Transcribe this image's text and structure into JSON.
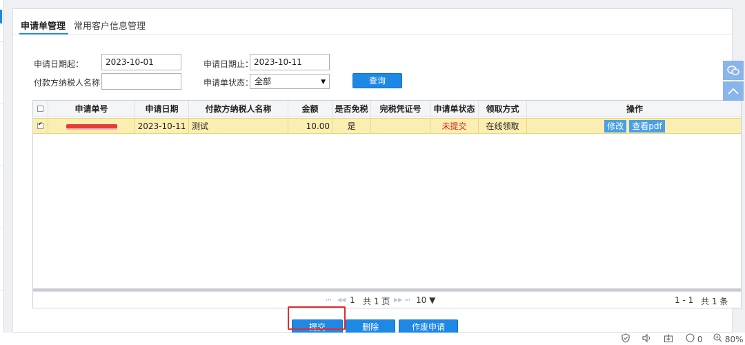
{
  "tabs": [
    {
      "label": "申请单管理"
    },
    {
      "label": "常用客户信息管理"
    }
  ],
  "filters": {
    "start_date_label": "申请日期起：",
    "start_date_value": "2023-10-01",
    "end_date_label": "申请日期止：",
    "end_date_value": "2023-10-11",
    "payer_label": "付款方纳税人名称：",
    "payer_value": "",
    "status_label": "申请单状态：",
    "status_value": "全部",
    "query_label": "查询"
  },
  "table": {
    "headers": [
      "申请单号",
      "申请日期",
      "付款方纳税人名称",
      "金额",
      "是否免税",
      "完税凭证号",
      "申请单状态",
      "领取方式",
      "操作"
    ],
    "rows": [
      {
        "date": "2023-10-11",
        "payer": "测试",
        "amount": "10.00",
        "tax_exempt": "是",
        "voucher": "",
        "status": "未提交",
        "pickup": "在线领取",
        "actions": [
          "修改",
          "查看pdf"
        ]
      }
    ]
  },
  "pager": {
    "page": "1",
    "total_pages": "共 1 页",
    "page_size": "10 ▼",
    "range": "1 - 1",
    "total_items": "共 1 条"
  },
  "actions": {
    "submit": "提交",
    "delete": "删除",
    "void": "作废申请"
  },
  "statusbar": {
    "count": "0",
    "zoom": "80%"
  },
  "colors": {
    "accent": "#1e88e5",
    "selected_row": "#fbeeb3",
    "status_red": "#e02020",
    "highlight_red": "#e42b2b"
  }
}
